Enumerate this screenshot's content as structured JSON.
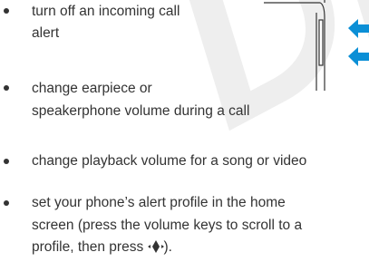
{
  "watermark": "DR",
  "bullets": [
    {
      "line1": "turn off an incoming call",
      "line2": "alert"
    },
    {
      "line1": "change earpiece or",
      "line2": "speakerphone volume during a call"
    },
    {
      "line1": "change playback volume for a song or video"
    },
    {
      "line1": "set your phone’s alert profile in the home",
      "line2": "screen (press the volume keys to scroll to a",
      "line3_before": "profile, then press ",
      "line3_after": ")."
    }
  ],
  "colors": {
    "arrow": "#0b8fd6",
    "text": "#333333",
    "watermark": "#eeeeee"
  },
  "icons": {
    "arrows": "volume-key-arrow-icon",
    "nav": "navigation-key-icon"
  }
}
